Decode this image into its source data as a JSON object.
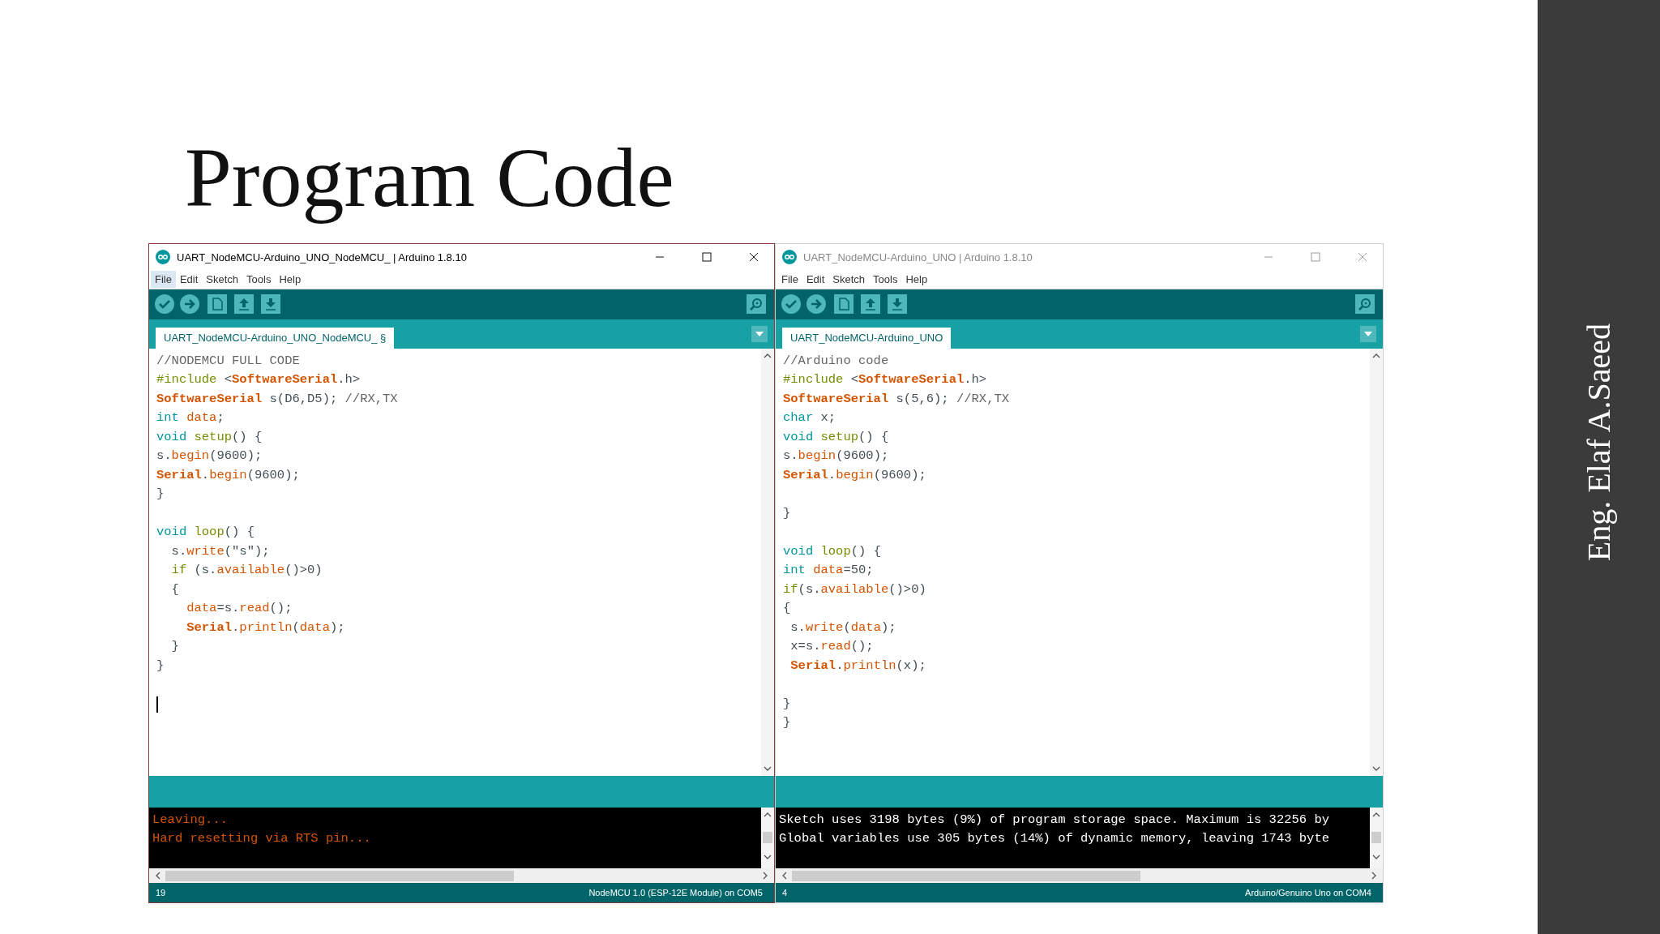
{
  "slide": {
    "title": "Program Code",
    "author": "Eng. Elaf A.Saeed"
  },
  "windows": [
    {
      "active": true,
      "title": "UART_NodeMCU-Arduino_UNO_NodeMCU_ | Arduino 1.8.10",
      "menu": [
        {
          "label": "File",
          "selected": true
        },
        {
          "label": "Edit",
          "selected": false
        },
        {
          "label": "Sketch",
          "selected": false
        },
        {
          "label": "Tools",
          "selected": false
        },
        {
          "label": "Help",
          "selected": false
        }
      ],
      "tab": {
        "label": "UART_NodeMCU-Arduino_UNO_NodeMCU_ §"
      },
      "code": [
        {
          "kind": "code",
          "tokens": [
            {
              "text": "//NODEMCU FULL CODE",
              "kind": "comment"
            }
          ]
        },
        {
          "kind": "code",
          "tokens": [
            {
              "text": "#include",
              "kind": "control"
            },
            {
              "text": " <",
              "kind": "plain"
            },
            {
              "text": "SoftwareSerial",
              "kind": "class"
            },
            {
              "text": ".h>",
              "kind": "plain"
            }
          ]
        },
        {
          "kind": "code",
          "tokens": [
            {
              "text": "SoftwareSerial",
              "kind": "class"
            },
            {
              "text": " s(D6,D5); ",
              "kind": "plain"
            },
            {
              "text": "//RX,TX",
              "kind": "comment"
            }
          ]
        },
        {
          "kind": "code",
          "tokens": [
            {
              "text": "int",
              "kind": "type"
            },
            {
              "text": " data",
              "kind": "method"
            },
            {
              "text": ";",
              "kind": "plain"
            }
          ]
        },
        {
          "kind": "code",
          "tokens": [
            {
              "text": "void",
              "kind": "type"
            },
            {
              "text": " setup",
              "kind": "control"
            },
            {
              "text": "() {",
              "kind": "plain"
            }
          ]
        },
        {
          "kind": "code",
          "tokens": [
            {
              "text": "s.",
              "kind": "plain"
            },
            {
              "text": "begin",
              "kind": "method"
            },
            {
              "text": "(9600);",
              "kind": "plain"
            }
          ]
        },
        {
          "kind": "code",
          "tokens": [
            {
              "text": "Serial",
              "kind": "class"
            },
            {
              "text": ".",
              "kind": "plain"
            },
            {
              "text": "begin",
              "kind": "method"
            },
            {
              "text": "(9600);",
              "kind": "plain"
            }
          ]
        },
        {
          "kind": "code",
          "tokens": [
            {
              "text": "}",
              "kind": "plain"
            }
          ]
        },
        {
          "kind": "blank"
        },
        {
          "kind": "code",
          "tokens": [
            {
              "text": "void",
              "kind": "type"
            },
            {
              "text": " loop",
              "kind": "control"
            },
            {
              "text": "() {",
              "kind": "plain"
            }
          ]
        },
        {
          "kind": "code",
          "tokens": [
            {
              "text": "  s.",
              "kind": "plain"
            },
            {
              "text": "write",
              "kind": "method"
            },
            {
              "text": "(\"s\");",
              "kind": "plain"
            }
          ]
        },
        {
          "kind": "code",
          "tokens": [
            {
              "text": "  if",
              "kind": "control"
            },
            {
              "text": " (s.",
              "kind": "plain"
            },
            {
              "text": "available",
              "kind": "method"
            },
            {
              "text": "()>0)",
              "kind": "plain"
            }
          ]
        },
        {
          "kind": "code",
          "tokens": [
            {
              "text": "  {",
              "kind": "plain"
            }
          ]
        },
        {
          "kind": "code",
          "tokens": [
            {
              "text": "    data",
              "kind": "method"
            },
            {
              "text": "=s.",
              "kind": "plain"
            },
            {
              "text": "read",
              "kind": "method"
            },
            {
              "text": "();",
              "kind": "plain"
            }
          ]
        },
        {
          "kind": "code",
          "tokens": [
            {
              "text": "    Serial",
              "kind": "class"
            },
            {
              "text": ".",
              "kind": "plain"
            },
            {
              "text": "println",
              "kind": "method"
            },
            {
              "text": "(",
              "kind": "plain"
            },
            {
              "text": "data",
              "kind": "method"
            },
            {
              "text": ");",
              "kind": "plain"
            }
          ]
        },
        {
          "kind": "code",
          "tokens": [
            {
              "text": "  }",
              "kind": "plain"
            }
          ]
        },
        {
          "kind": "code",
          "tokens": [
            {
              "text": "}",
              "kind": "plain"
            }
          ]
        },
        {
          "kind": "blank"
        },
        {
          "kind": "cursor"
        }
      ],
      "console": [
        {
          "text": "Leaving...",
          "kind": "error"
        },
        {
          "text": "Hard resetting via RTS pin...",
          "kind": "error"
        }
      ],
      "status_bar": {
        "line": "19",
        "board": "NodeMCU 1.0 (ESP-12E Module) on COM5"
      }
    },
    {
      "active": false,
      "title": "UART_NodeMCU-Arduino_UNO | Arduino 1.8.10",
      "menu": [
        {
          "label": "File",
          "selected": false
        },
        {
          "label": "Edit",
          "selected": false
        },
        {
          "label": "Sketch",
          "selected": false
        },
        {
          "label": "Tools",
          "selected": false
        },
        {
          "label": "Help",
          "selected": false
        }
      ],
      "tab": {
        "label": "UART_NodeMCU-Arduino_UNO"
      },
      "code": [
        {
          "kind": "code",
          "tokens": [
            {
              "text": "//Arduino code",
              "kind": "comment"
            }
          ]
        },
        {
          "kind": "code",
          "tokens": [
            {
              "text": "#include",
              "kind": "control"
            },
            {
              "text": " <",
              "kind": "plain"
            },
            {
              "text": "SoftwareSerial",
              "kind": "class"
            },
            {
              "text": ".h>",
              "kind": "plain"
            }
          ]
        },
        {
          "kind": "code",
          "tokens": [
            {
              "text": "SoftwareSerial",
              "kind": "class"
            },
            {
              "text": " s(5,6); ",
              "kind": "plain"
            },
            {
              "text": "//RX,TX",
              "kind": "comment"
            }
          ]
        },
        {
          "kind": "code",
          "tokens": [
            {
              "text": "char",
              "kind": "type"
            },
            {
              "text": " x;",
              "kind": "plain"
            }
          ]
        },
        {
          "kind": "code",
          "tokens": [
            {
              "text": "void",
              "kind": "type"
            },
            {
              "text": " setup",
              "kind": "control"
            },
            {
              "text": "() {",
              "kind": "plain"
            }
          ]
        },
        {
          "kind": "code",
          "tokens": [
            {
              "text": "s.",
              "kind": "plain"
            },
            {
              "text": "begin",
              "kind": "method"
            },
            {
              "text": "(9600);",
              "kind": "plain"
            }
          ]
        },
        {
          "kind": "code",
          "tokens": [
            {
              "text": "Serial",
              "kind": "class"
            },
            {
              "text": ".",
              "kind": "plain"
            },
            {
              "text": "begin",
              "kind": "method"
            },
            {
              "text": "(9600);",
              "kind": "plain"
            }
          ]
        },
        {
          "kind": "blank"
        },
        {
          "kind": "code",
          "tokens": [
            {
              "text": "}",
              "kind": "plain"
            }
          ]
        },
        {
          "kind": "blank"
        },
        {
          "kind": "code",
          "tokens": [
            {
              "text": "void",
              "kind": "type"
            },
            {
              "text": " loop",
              "kind": "control"
            },
            {
              "text": "() {",
              "kind": "plain"
            }
          ]
        },
        {
          "kind": "code",
          "tokens": [
            {
              "text": "int",
              "kind": "type"
            },
            {
              "text": " data",
              "kind": "method"
            },
            {
              "text": "=50;",
              "kind": "plain"
            }
          ]
        },
        {
          "kind": "code",
          "tokens": [
            {
              "text": "if",
              "kind": "control"
            },
            {
              "text": "(s.",
              "kind": "plain"
            },
            {
              "text": "available",
              "kind": "method"
            },
            {
              "text": "()>0)",
              "kind": "plain"
            }
          ]
        },
        {
          "kind": "code",
          "tokens": [
            {
              "text": "{",
              "kind": "plain"
            }
          ]
        },
        {
          "kind": "code",
          "tokens": [
            {
              "text": " s.",
              "kind": "plain"
            },
            {
              "text": "write",
              "kind": "method"
            },
            {
              "text": "(",
              "kind": "plain"
            },
            {
              "text": "data",
              "kind": "method"
            },
            {
              "text": ");",
              "kind": "plain"
            }
          ]
        },
        {
          "kind": "code",
          "tokens": [
            {
              "text": " x=s.",
              "kind": "plain"
            },
            {
              "text": "read",
              "kind": "method"
            },
            {
              "text": "();",
              "kind": "plain"
            }
          ]
        },
        {
          "kind": "code",
          "tokens": [
            {
              "text": " Serial",
              "kind": "class"
            },
            {
              "text": ".",
              "kind": "plain"
            },
            {
              "text": "println",
              "kind": "method"
            },
            {
              "text": "(x);",
              "kind": "plain"
            }
          ]
        },
        {
          "kind": "blank"
        },
        {
          "kind": "code",
          "tokens": [
            {
              "text": "}",
              "kind": "plain"
            }
          ]
        },
        {
          "kind": "code",
          "tokens": [
            {
              "text": "}",
              "kind": "plain"
            }
          ]
        }
      ],
      "console": [
        {
          "text": "Sketch uses 3198 bytes (9%) of program storage space. Maximum is 32256 by",
          "kind": "info"
        },
        {
          "text": "Global variables use 305 bytes (14%) of dynamic memory, leaving 1743 byte",
          "kind": "info"
        }
      ],
      "status_bar": {
        "line": "4",
        "board": "Arduino/Genuino Uno on COM4"
      }
    }
  ]
}
